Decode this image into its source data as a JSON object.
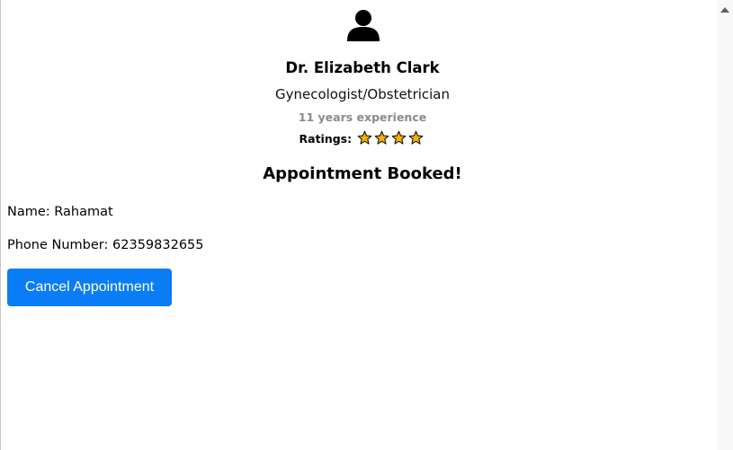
{
  "doctor": {
    "avatar_icon": "user-icon",
    "name": "Dr. Elizabeth Clark",
    "specialty": "Gynecologist/Obstetrician",
    "experience": "11 years experience",
    "ratings_label": "Ratings:",
    "rating_stars": 4,
    "star_icon": "star-icon",
    "star_color": "#f4b400"
  },
  "booking": {
    "heading": "Appointment Booked!",
    "name_line": "Name: Rahamat",
    "phone_line": "Phone Number: 62359832655",
    "cancel_label": "Cancel Appointment"
  },
  "colors": {
    "accent": "#0a7cf6",
    "muted_text": "#8a8a8a"
  }
}
